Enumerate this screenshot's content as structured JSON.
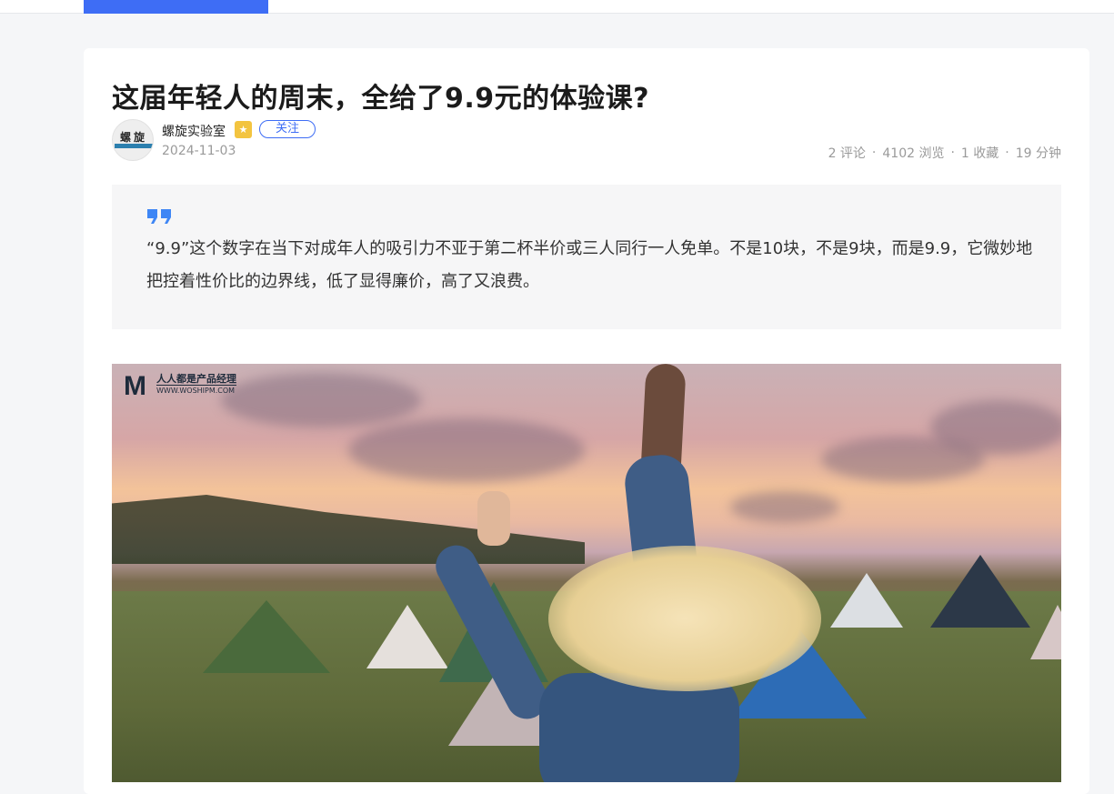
{
  "article": {
    "title": "这届年轻人的周末，全给了9.9元的体验课?",
    "author": {
      "name": "螺旋实验室",
      "avatar_text": "螺旋",
      "badge_icon": "vip-star-icon",
      "follow_label": "关注"
    },
    "date": "2024-11-03",
    "stats": {
      "comments": "2 评论",
      "views": "4102 浏览",
      "favorites": "1 收藏",
      "read_time": "19 分钟",
      "separator": "·"
    },
    "quote": "“9.9”这个数字在当下对成年人的吸引力不亚于第二杯半价或三人同行一人免单。不是10块，不是9块，而是9.9，它微妙地把控着性价比的边界线，低了显得廉价，高了又浪费。",
    "hero_image": {
      "watermark_logo": "M",
      "watermark_line1": "人人都是产品经理",
      "watermark_line2": "WWW.WOSHIPM.COM"
    }
  },
  "colors": {
    "accent": "#3e6df5",
    "badge": "#f3c440",
    "quote_icon": "#3e86f5"
  }
}
